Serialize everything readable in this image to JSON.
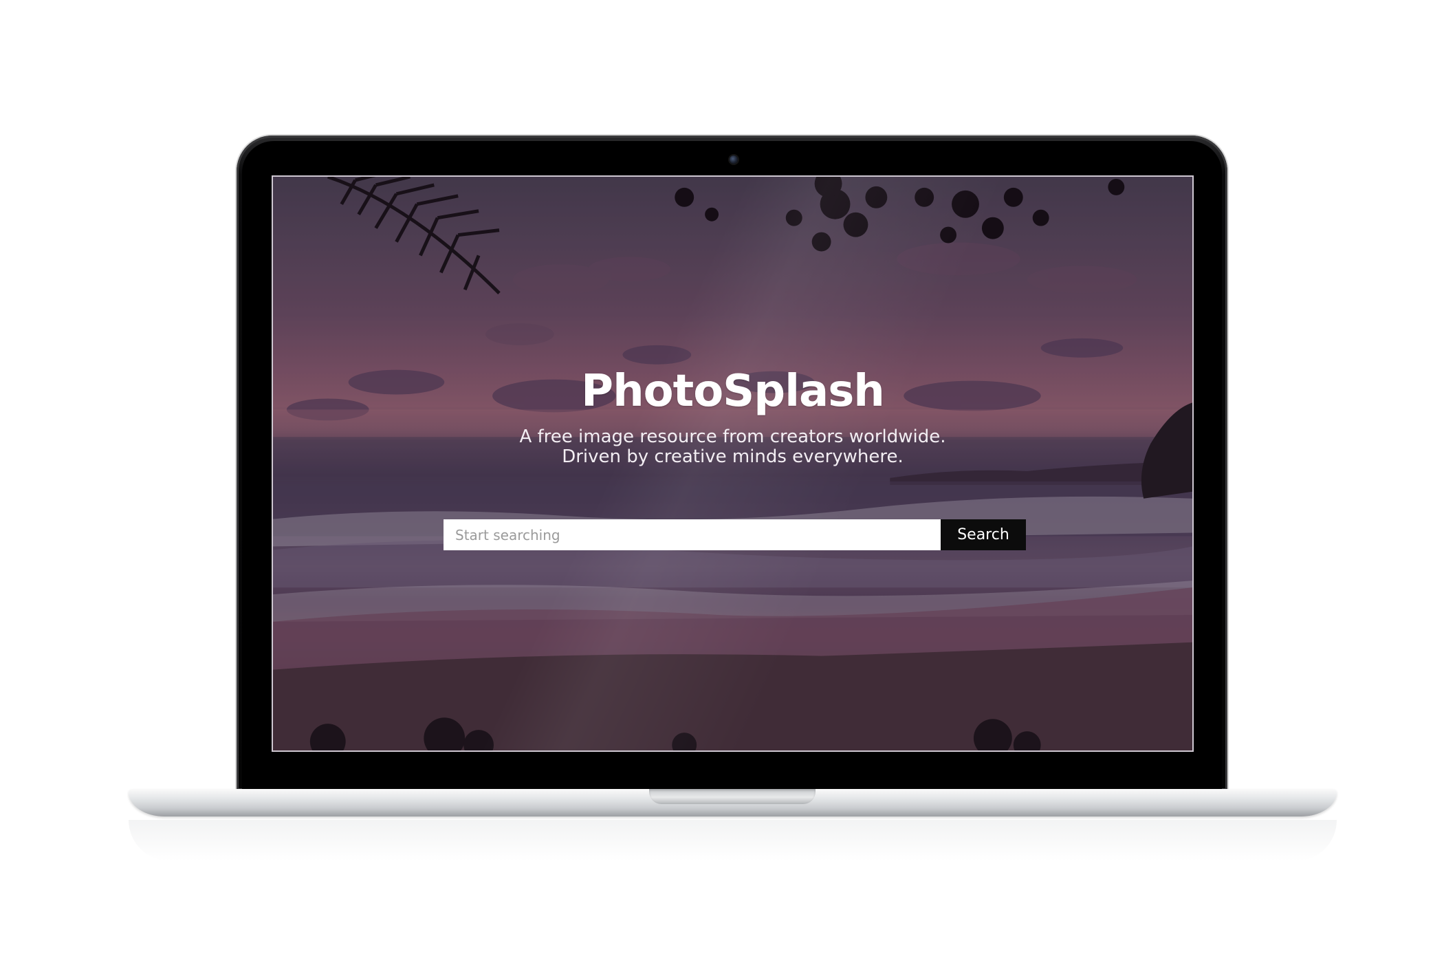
{
  "hero": {
    "title": "PhotoSplash",
    "tagline_line1": "A free image resource from creators worldwide.",
    "tagline_line2": "Driven by creative minds everywhere."
  },
  "search": {
    "placeholder": "Start searching",
    "value": "",
    "button_label": "Search"
  },
  "colors": {
    "button_bg": "#0c0c0c",
    "text": "#ffffff",
    "input_bg": "#ffffff"
  }
}
